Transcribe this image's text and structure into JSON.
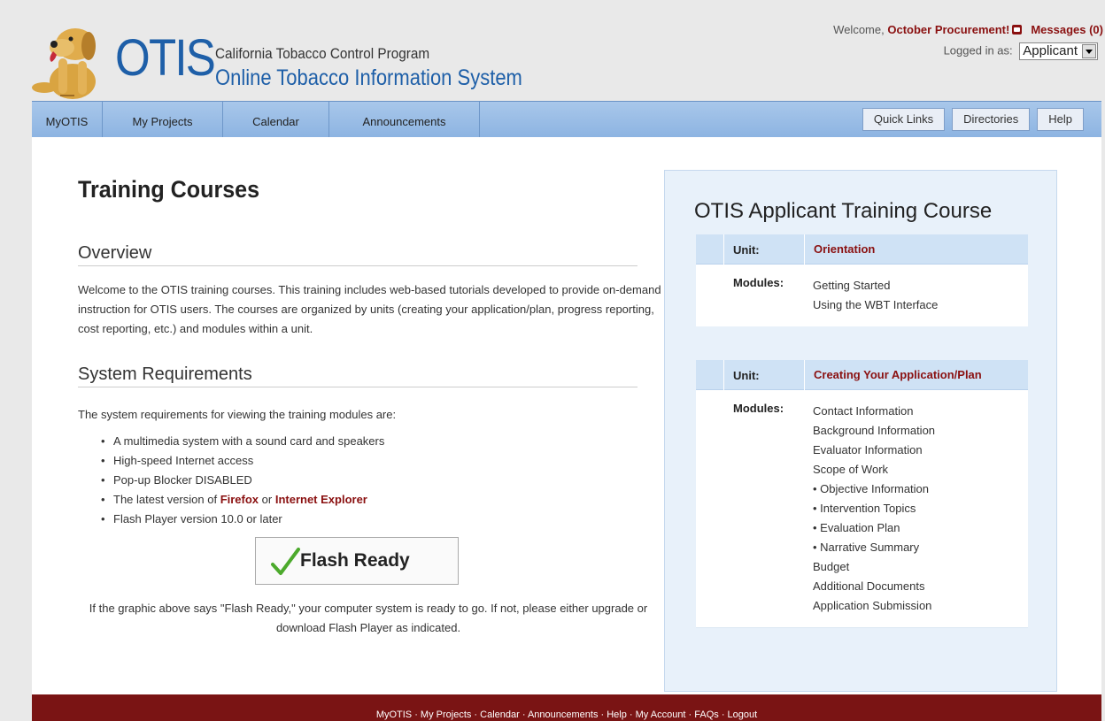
{
  "header": {
    "logo_text": "OTIS",
    "program_name": "California Tobacco Control Program",
    "system_name": "Online Tobacco Information System",
    "welcome_prefix": "Welcome,",
    "user_name": "October Procurement!",
    "messages_label": "Messages (0)",
    "logged_in_label": "Logged in as:",
    "role_value": "Applicant"
  },
  "nav": {
    "items": [
      "MyOTIS",
      "My Projects",
      "Calendar",
      "Announcements"
    ],
    "quick": [
      "Quick Links",
      "Directories",
      "Help"
    ]
  },
  "main": {
    "title": "Training Courses",
    "overview_heading": "Overview",
    "overview_text": "Welcome to the OTIS training courses. This training includes web-based tutorials developed to provide on-demand instruction for OTIS users. The courses are organized by units (creating your application/plan, progress reporting, cost reporting, etc.) and modules within a unit.",
    "sysreq_heading": "System Requirements",
    "sysreq_intro": "The system requirements for viewing the training modules are:",
    "requirements": [
      "A multimedia system with a sound card and speakers",
      "High-speed Internet access",
      "Pop-up Blocker DISABLED"
    ],
    "browser_req_prefix": "The latest version of",
    "browser_firefox": "Firefox",
    "browser_or": "or",
    "browser_ie": "Internet Explorer",
    "flash_req": "Flash Player version 10.0 or later",
    "flash_badge": "Flash Ready",
    "flash_note": "If the graphic above says \"Flash Ready,\" your computer system is ready to go. If not, please either upgrade or download Flash Player as indicated."
  },
  "panel": {
    "title": "OTIS Applicant Training Course",
    "unit_label": "Unit:",
    "modules_label": "Modules:",
    "units": [
      {
        "name": "Orientation",
        "modules": [
          "Getting Started",
          "Using the WBT Interface"
        ]
      },
      {
        "name": "Creating Your Application/Plan",
        "modules": [
          "Contact Information",
          "Background Information",
          "Evaluator Information",
          "Scope of Work",
          "Objective Information",
          "Intervention Topics",
          "Evaluation Plan",
          "Narrative Summary",
          "Budget",
          "Additional Documents",
          "Application Submission"
        ]
      }
    ]
  },
  "footer": {
    "links": "MyOTIS · My Projects · Calendar · Announcements · Help · My Account · FAQs · Logout"
  },
  "colors": {
    "brand_blue": "#1e5fa8",
    "dark_red": "#8a1010",
    "nav_blue": "#8db4e2",
    "footer_red": "#7a1414"
  }
}
